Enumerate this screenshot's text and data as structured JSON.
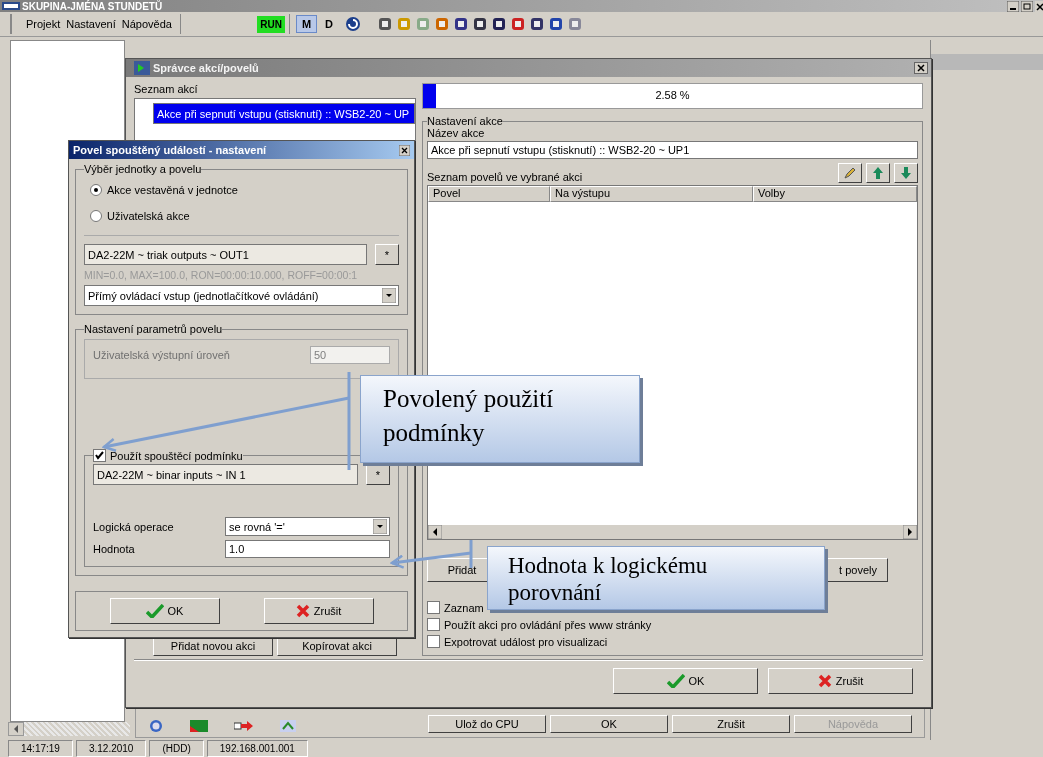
{
  "window": {
    "title": "SKUPINA-JMÉNA STUNDETŮ"
  },
  "menu": [
    {
      "label": "Projekt"
    },
    {
      "label": "Nastavení"
    },
    {
      "label": "Nápověda"
    }
  ],
  "toolbar": {
    "run_label": "RUN",
    "modes": [
      {
        "label": "M",
        "selected": true
      },
      {
        "label": "D",
        "selected": false
      }
    ]
  },
  "manager": {
    "title": "Správce akcí/povelů",
    "actions_label": "Seznam akcí",
    "actions": [
      {
        "label": "Akce při sepnutí vstupu (stisknutí) :: WSB2-20 ~ UP",
        "selected": true
      }
    ],
    "progress": {
      "level": 0.026,
      "reading": "2.58 %"
    },
    "group_title": "Nastavení akce",
    "name_label": "Název akce",
    "name_value": "Akce při sepnutí vstupu (stisknutí) :: WSB2-20 ~ UP1",
    "commands_label": "Seznam povelů ve vybrané akci",
    "columns": [
      "Povel",
      "Na výstupu",
      "Volby"
    ],
    "command_buttons": [
      "Přidat",
      "t povely"
    ],
    "options": [
      {
        "label": "Zaznam",
        "checked": false
      },
      {
        "label": "Použít akci pro ovládání přes www stránky",
        "checked": false
      },
      {
        "label": "Expotrovat událost pro visualizaci",
        "checked": false
      }
    ],
    "action_buttons": [
      "Přidat novou akci",
      "Kopírovat akci"
    ],
    "ok": "OK",
    "cancel": "Zrušit"
  },
  "footer_buttons": [
    {
      "label": "Ulož do CPU",
      "disabled": false
    },
    {
      "label": "OK",
      "disabled": false
    },
    {
      "label": "Zrušit",
      "disabled": false
    },
    {
      "label": "Nápověda",
      "disabled": true
    }
  ],
  "dialog": {
    "title": "Povel spouštěný událostí - nastavení",
    "unit_group": "Výběr jednotky a povelu",
    "radios": [
      {
        "label": "Akce vestavěná v jednotce",
        "selected": true
      },
      {
        "label": "Uživatelská akce",
        "selected": false
      }
    ],
    "output": "DA2-22M ~ triak outputs ~ OUT1",
    "pick": "*",
    "info": "MIN=0.0, MAX=100.0, RON=00:00:10.000, ROFF=00:00:1",
    "mode": "Přímý ovládací vstup (jednotlačítkové ovládání)",
    "params_group": "Nastavení parametrů povelu",
    "level_label": "Uživatelská výstupní úroveň",
    "level_value": "50",
    "level_disabled": true,
    "condition": {
      "label": "Použít spouštěcí podmínku",
      "checked": true,
      "input": "DA2-22M ~ binar inputs ~ IN 1",
      "pick": "*",
      "op_label": "Logická operace",
      "op_value": "se rovná '='",
      "value_label": "Hodnota",
      "value": "1.0"
    },
    "ok": "OK",
    "cancel": "Zrušit"
  },
  "callouts": [
    "Povolený použití podmínky",
    "Hodnota k logickému porovnání"
  ],
  "status_bar": [
    "14:17:19",
    "3.12.2010",
    "(HDD)",
    "192.168.001.001"
  ]
}
